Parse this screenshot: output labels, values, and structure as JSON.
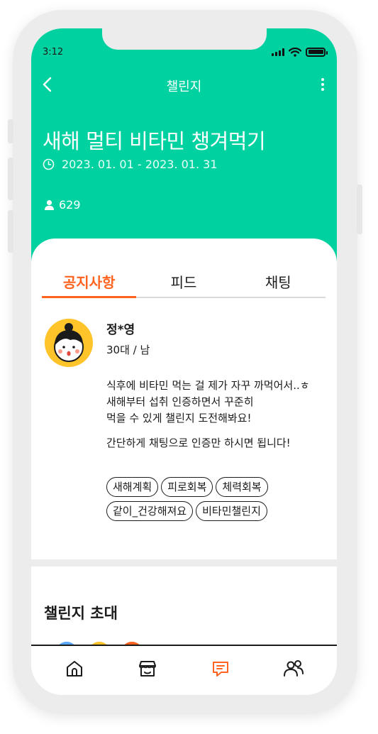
{
  "status_bar": {
    "time": "3:12"
  },
  "header": {
    "title": "챌린지"
  },
  "challenge": {
    "title": "새해 멀티 비타민 챙겨먹기",
    "period": "2023. 01. 01 - 2023. 01. 31",
    "participants": "629"
  },
  "tabs": [
    {
      "label": "공지사항",
      "active": true
    },
    {
      "label": "피드",
      "active": false
    },
    {
      "label": "채팅",
      "active": false
    }
  ],
  "author": {
    "name": "정*영",
    "meta": "30대 / 남"
  },
  "notice": {
    "line1": "식후에 비타민 먹는 걸 제가 자꾸 까먹어서..ㅎ",
    "line2": "새해부터 섭취 인증하면서 꾸준히",
    "line3": "먹을 수 있게 챌린지 도전해봐요!",
    "line4": "간단하게 채팅으로 인증만 하시면 됩니다!"
  },
  "tags": [
    "새해계획",
    "피로회복",
    "체력회복",
    "같이_건강해져요",
    "비타민챌린지"
  ],
  "invite": {
    "title": "챌린지 초대"
  },
  "bottom_nav": [
    {
      "icon": "home-icon",
      "active": false
    },
    {
      "icon": "store-icon",
      "active": false
    },
    {
      "icon": "chat-icon",
      "active": true
    },
    {
      "icon": "people-icon",
      "active": false
    }
  ],
  "colors": {
    "brand": "#00d1a0",
    "accent": "#ff6320",
    "avatar_bg": "#ffc42a"
  }
}
